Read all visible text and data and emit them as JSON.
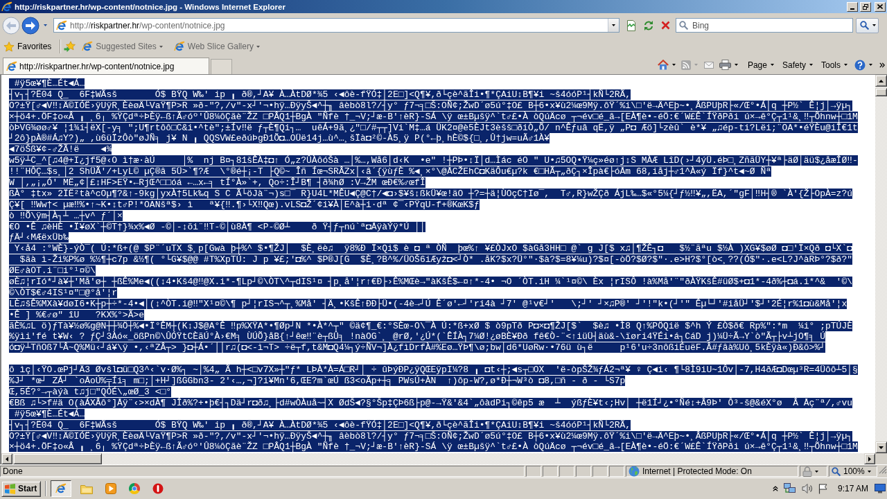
{
  "window": {
    "title": "http://riskpartner.hr/wp-content/notnice.jpg - Windows Internet Explorer"
  },
  "nav_buttons": [
    {
      "kind": "back",
      "disabled": true
    },
    {
      "kind": "forward",
      "disabled": false
    }
  ],
  "address_bar": {
    "scheme": "http://",
    "domain": "riskpartner.hr",
    "path": "/wp-content/notnice.jpg"
  },
  "search": {
    "placeholder": "Bing"
  },
  "favorites_bar": {
    "label": "Favorites",
    "items": [
      {
        "label": "Suggested Sites"
      },
      {
        "label": "Web Slice Gallery"
      }
    ]
  },
  "tabs": [
    {
      "label": "http://riskpartner.hr/wp-content/notnice.jpg",
      "selected": true
    }
  ],
  "command_bar": {
    "items": [
      {
        "label": "Page"
      },
      {
        "label": "Safety"
      },
      {
        "label": "Tools"
      }
    ]
  },
  "document": {
    "selected": true,
    "paragraphs": [
      [
        " #ÿ5œ¥¶È…Ét◄Á…",
        "┤v┐┤?Ë04 Q_  6F‡WÃsš       Ó$ BŸQ W‰' ip ╻ ð®,┘A¥ À…ÀtDØ*¾5 ‹◄ôè-fŸÓ‡│2E□]<Q¶¥,ð└çè^ãÎi•¶*ÇAiU↕B¶¥i ~š4óóP¹┤kÑ└2RÃ,",
        "O?±Ÿ[♂◄V‼↕Ä©IÓË›ÿUÿR¸ÈèøÄ└VaŸ¶P>R »ð-\"?,/v\"-x┘'¬•hÿ…ÐÿyŠ◄^┼╖ âèbò8l?/┤y° ƒ7¬╕□Š:OÑ¢;ŽwD´ø5ú°‡O£ B┼6•x¥ù2¼œ9Mÿ.ôŸ´%i\\□'ë→Ä^Eþ~•¸ÂßPUþR├«/Œ°•Á│q ┼P½` Ê¦j│→ÿµ┐",
        "×┼ö4+.ÖF‡o«Â ╻ ¸6╷ %ŸÇdª÷ÞÈÿ←ß↑Ã♂óº'Û8¼ôÇãè¨ŽZ □PÂQ1┼BgÀ \"Ñfè †_¬V;┘æ-B'↑èR}-SÁ \\ÿ œ±Bµšÿ^`t♂£•À òQúÄcø ┬¬év□é_â→[EÀ¶è•-éÖ:€´W£Ê`ÍŸðPði ú×→ê°Ç┬1¹&¸‼┬Õhnw┼□1M",
        "òÞVG¾øø♂¥ ¦1¾i┤ëX[-y╕ \";U¶rtôô□C&i•^tè\";±Ív‼ë ƒ┬È¶Qi┐…  uêÁ+9ã¸¿\"□/#┬┬]Vi`M‡…á ÜK2¤@è5ÈJt3èšš□ðiÒ„Õ/ n^Êƒuâ qË,ÿ „P◘ Æö]└zèû` è*¥ „♫ép-ti?Lëi;¨OA*•éŸÈu@iÎ€1t",
        "┘2ô}pÀ®#Á♫Y?)„ ,ù6üÏzÔò\"øJÑ╕ j¥ N ╻ QQSVW£eðúÞgÐ1Õ◘…OÜë14j…ù^…¸šÏà◘²©-À5¸ÿ P(°←þ¸hÈ©${□¸,Û†jw=uÃ♂1À¥",
        "◄7öŠß¥¢-♂ŽÃ!ë    ◄¾",
        "w5ÿ┴C_^[♫4@+I¿jf5@‹O ì†æ·àÚ     │%  nj B¤┐81šÊÀ‡◘↑ Ó„z?ÛÀôóŠà …│%…,Wå6│d‹K  •e\" !┼PÞ•↕Ï│d…Ìác éO \" U•♫5OQ•Ÿ¼ç»éø↑j↕S MÀÆ LîD(›┘4ýÜ.éÞ□¸ZñãÜY┼¥ª├äØ│äü$¿åæÎØ‼-",
        "!!¨HÔÇ…$s¸│2 ShÜÃ'/+LyL© µÇ®â 5Ü>`¶?Æ  \\°®é┼¡-T ├Q©~ Îñ Íœ¬SRÂZx│‹â´{ÿùƒÈ %◄¸×°\\@ÅCŽEhC◘KäÔu€µ?k €□HÃ┬„ðÇ┐×Îpà€├óÅm 68,iåj┼♂1^À«ý Ïf}^t◄~Ø Ñª",
        "W │,„¡„Ó' MË„¢│£↕HF>EŸ•←RjŒ^□□óá ←…x←╕ tÍ°À»`+, Qo÷:Î┘B¶ ┤ð¾hØ :V→ŽM œÐ€%♂œfÎ",
        "ßÀ° ‡tx» 2ÏË²tà^cOµ¶?&↑-9kg│yxÀ†5Lk‰q S C Ã└öJà¨¬)s□¯ R}U4L*MÊU◄Ç@C†/◄◘›$¥š↕ßkÜ¥œ!äO ┼?=┼ä¦ÙOçC†Iø¯,  T♂,R}wŽÇð ÁjL‰…$«°5¼{┘ƒ½‼¥„,ËA,´\"gF│‼H┤® `À'{Ž├OpÀ=z?ú",
        "Ç¥[ ‼Ww†< µæ‼%•↑~K•↕t♂P!*OANšª$› ì   ª¥{‼.¶›└X‼Qœ).vLS◘Ž´¢i¥À│E^à┼i·dª ¢¯‹PŸqU-f+®KœK$ƒ",
        "ò ‼Õ\\ÿm┤À┐┴ …┼v^ ƒ´│×",
        "€O •Ê ♫èHÈ •Ï¥øX`┼©T†}¾x%◄Ø -©│-↕õi¨‼T-©│ù8À¶ <P-©Ø┴    ð Ÿ┤ƒ┬nú`ª◘ÅÿàÝÿ*Ú ││",
        "ƒÄ┘‹MÆëxÜb‰",
        " Y‹å4 :°WÈ}-ýÒ¯( Ú:*ß+(@ $P¨´uTX $¸p[Gwà þ┼%^ $•¶ŽJ│  $È¸ëè♫  ÿ8%Ð Ï×Qi$ è ◘ ª ÒÑ  þœ%↑ ¥£ÒJxO $àGå3HH□ @` g J[$ x♫│¶ŽÊ┐◘   $½¨ãªu $½À )XG¥$øØ ◘□'Ï×Qð ◘└X`◘",
        "  $ãà ì-Ži%P%ø %½¶┼c7p &½¶( °└G¥$@@ #T%XpTÚ: J p ¥£;'◘%^ $P®J[G  $È¸?B^%/ÜOŠ6iÆyž◘<┘Ò* .åK?$x?Ü°″·$à?$=8¥¼u)?$¤[-òÖ?$Ø?$″·.e>H?$°[ò<¸??(Ó$″·.e<L?J^àRÞ°?$ð?\"",
        "ØE♂àOT.i¨□i°¹¤©\\",
        "øÈ♫¦rIó*┘à¥┼'Må'ø┼ ┼ßÊ%Me◄((↕4•Kš4@‼@X.i*-¶Lp┘©\\ÒT\\^┬dIS¹¤ ┤p¸å'¦r↑€Ð├›Ê%MŒè→\"àKšÊ$←¤↑*-4• ¬O ´ÒT.iH ¼`¹¤©\\ Èx ¦rISÔ !à%Må'¨\"ðÀŸKšÊ#üØ$+◘1*-4ð%┼◘á.i*^&  '©\\",
        "©\\ÒT$€♂4IS¹¤\"□@°å'¦r",
        "LÈ♫šÊ%MXà¥døI6•K┼p┼÷*-4•◄│(↕^ÒT.i@‼\"X¹¤©\\¶ p┘¦rIS¬^┬¸%Må' ┤Ä¸•KšÊ↑ÐÐ├Ü•(-4è→┘Ú Ê´ø'←┘'ri4à ┘7' @¹v€┘'   \\;┘' ┘×♫P®' ┘'!\"k•(┘'\" Êµ└┘'#iåÜ┘'$┘'2É¦r%1◘ù&Må'¦x",
        "•Ê ] %€♂ø\" îU   ?KX%°>Ã>e",
        "ãÈ%♫L ö)ƒTà¥½ø%g@N┼┼¾Ö┼%◄•Ï°ÊM┼(K↕J$@A°Ê ‼p%XŸA*•¶Øp┘N *•À*^┬\" ©ä¢¶_€:°SÈœ-O\\¯À Ú:*ß+xØ $ ò9pTð P◘×◘¶ŽJ[$`  $è♫ •Ì8 Q↑%PÖQië $^h Ý £Ò$ð€ Rp%\":*m  ¼i° ;pTÚJÈ",
        "%ÿìi'fé t¥W‹ ? ƒÇ┘3Àó«_ößPn©\\ÛÓŸtCÈãÚ°À›€M╕ ÙÚÕ}åB{↑┘êœ‼¨è┬ßÛ╕ !nàOG`¸ @rØ,'¿Ú*(`ÊÍÀ┐7¼Ø!¿øBÈ¥Ðð fê€Ò-¨<↑iüÜ┤äù&-\\ïøri4ŸÉi•á┐CáD j)¼Ü÷Ã→Y`ò\"Ã┬├v┴jO¶╕ Ú",
        "ó◘ÿ┴TñOß7└Â~Q%Mü‹┘á¥\\ÿ •,‹ªZÂ┬> }◘┼Á•´││r♫(◘<-ì¬T> ÷ë┬f,t&M◘Q4¼┐ý÷ÑV¬]À¿fìDrfÀ#%Eø…ŸÞ¶\\ø;bw│d6*UøRw·•76ü ù┐ë     p¹6'u÷3nôßiÉuëF.Â#ƒâà%Uô¸5kÈÿà«)Ð&ô>%┘"
      ],
      [
        "ô ìç│‹ŸO.œPj┘Ä3 Øvšl◘ü□Q3^‹`v·Ø%┐ ~│%4„ Ã h┼<□v7X»┼\"ƒ* LÞÀ*À=Á□R┘│ ÷ ûÞýÐP¿ÿQŒEÿpI¼?8 ╻ ◘t‹┼;◄s┬□OX  'ë-òpŠŽ¾ƒÁ2¬ª¥ ♀ Ç◄i‹ ¶└8Ì9iU~1Ôv│-7,H4ðÆ◘Dœµ³R=4Üôô┴5│§",
        "%J┘ *œ┘ ZÁ┘ `oÅoÚ%╤Íi╕ m□;│+H┘]ßGGbn3- 2'‹…,¬]?i¥Mn'6,ŒE?m`œÚ ß3<oÃp+┼╕ PWsÚ+ÀN  ↑)ôp-W?,ø*Ð┼¬W³ò ◘8,□ñ - ð - └S7p",
        "Œ,5É?°→┬àýà t♫j□\"QÓÉ\\„œØ_3 <□°",
        "€Bß ♫└>f#ä O(àÁXÂô°]Åÿ¨‹>×dÀ¶ JÎð%?+•þ€┤┐Dä┘r◘ð♫¸├d#wÒÀuå~┤X ØdŠ◄?§°Šp‡ÇÞ6ß├p@-→Ÿ&'&4`„ôàdPi┐©êp5 æ  ┴  ýßƒÈ¥t‹;Hv│ ┼ë1Í┘¿•°Ñé↕+Â9Þ' Ô³-š@&éX°ø  Â Åç¨ª/,♂vu",
        " #ÿ5œ¥¶È…Ét◄Á…",
        "┤v┐┤?Ë04 Q_  6F‡WÃsš       Ó$ BŸQ W‰' ip ╻ ð®,┘A¥ À…ÀtDØ*¾5 ‹◄ôè-fŸÓ‡│2E□]<Q¶¥,ð└çè^ãÎi•¶*ÇAiU↕B¶¥i ~š4óóP¹┤kÑ└2RÃ,",
        "O?±Ÿ[♂◄V‼↕Ä©IÓË›ÿUÿR¸ÈèøÄ└VaŸ¶P>R »ð-\"?,/v\"-x┘'¬•hÿ…ÐÿyŠ◄^┼╖ âèbò8l?/┤y° ƒ7¬╕□Š:OÑ¢;ŽwD´ø5ú°‡O£ B┼6•x¥ù2¼œ9Mÿ.ôŸ´%i\\□'ë→Ä^Eþ~•¸ÂßPUþR├«/Œ°•Á│q ┼P½` Ê¦j│→ÿµ┐",
        "×┼ö4+.ÖF‡o«Â ╻ ¸6╷ %ŸÇdª÷ÞÈÿ←ß↑Ã♂óº'Û8¼ôÇãè¨ŽZ □PÂQ1┼BgÀ \"Ñfè †_¬V;┘æ-B'↑èR}-SÁ \\ÿ œ±Bµšÿ^`t♂£•À òQúÄcø ┬¬év□é_â→[EÀ¶è•-éÖ:€´W£Ê`ÍŸðPði ú×→ê°Ç┬1¹&¸‼┬Õhnw┼□1M"
      ]
    ]
  },
  "status_bar": {
    "text": "Done",
    "zone": "Internet | Protected Mode: On",
    "zoom": "100%"
  },
  "taskbar": {
    "start": "Start",
    "clock": "9:17 AM"
  }
}
